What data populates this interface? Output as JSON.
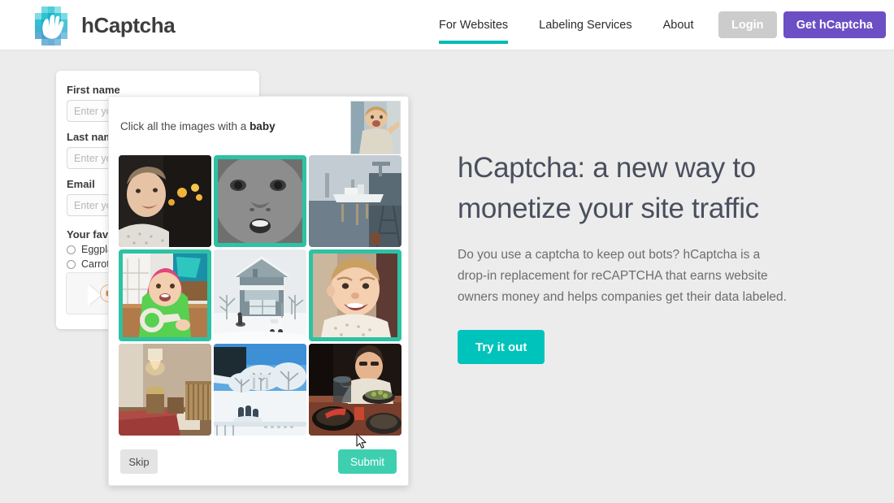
{
  "header": {
    "brand_name": "hCaptcha",
    "logo_icon": "hcaptcha-hand-logo",
    "nav": [
      {
        "label": "For Websites",
        "active": true
      },
      {
        "label": "Labeling Services",
        "active": false
      },
      {
        "label": "About",
        "active": false
      }
    ],
    "login_label": "Login",
    "get_label": "Get hCaptcha"
  },
  "form": {
    "first_name_label": "First name",
    "first_name_placeholder": "Enter your first name",
    "last_name_label": "Last name",
    "last_name_placeholder": "Enter your last name",
    "email_label": "Email",
    "email_placeholder": "Enter your email",
    "radio_group_label": "Your favorite vegetable",
    "radio_options": [
      {
        "label": "Eggplant",
        "checked": false
      },
      {
        "label": "Carrot",
        "checked": false
      }
    ],
    "widget_icon": "loading-spinner"
  },
  "captcha": {
    "prompt_prefix": "Click all the images with a ",
    "prompt_target": "baby",
    "example_thumb_alt": "baby-example-thumbnail",
    "skip_label": "Skip",
    "submit_label": "Submit",
    "tiles": [
      {
        "alt": "man-smiling-dark-room",
        "selected": false,
        "scene": "man-portrait"
      },
      {
        "alt": "baby-face-closeup-grayscale",
        "selected": true,
        "scene": "baby-bw"
      },
      {
        "alt": "harbor-ship-crane",
        "selected": false,
        "scene": "harbor"
      },
      {
        "alt": "baby-green-jacket-holding-toy",
        "selected": true,
        "scene": "baby-green"
      },
      {
        "alt": "snow-covered-house",
        "selected": false,
        "scene": "snow-house"
      },
      {
        "alt": "baby-smiling-closeup",
        "selected": true,
        "scene": "baby-color"
      },
      {
        "alt": "bedroom-with-crib",
        "selected": false,
        "scene": "bedroom"
      },
      {
        "alt": "snowy-garden-blue-sky",
        "selected": false,
        "scene": "snow-garden"
      },
      {
        "alt": "woman-cooking-at-table",
        "selected": false,
        "scene": "cooking"
      }
    ]
  },
  "hero": {
    "title": "hCaptcha: a new way to monetize your site traffic",
    "body": "Do you use a captcha to keep out bots? hCaptcha is a drop-in replacement for reCAPTCHA that earns website owners money and helps companies get their data labeled.",
    "cta_label": "Try it out"
  },
  "colors": {
    "teal_accent": "#00bcb4",
    "teal_cta": "#00c4bb",
    "teal_submit": "#3ecfb0",
    "selection_border": "#2dc2a4",
    "purple_cta": "#6c4fc4",
    "page_bg": "#ececec",
    "header_bg": "#ffffff"
  }
}
